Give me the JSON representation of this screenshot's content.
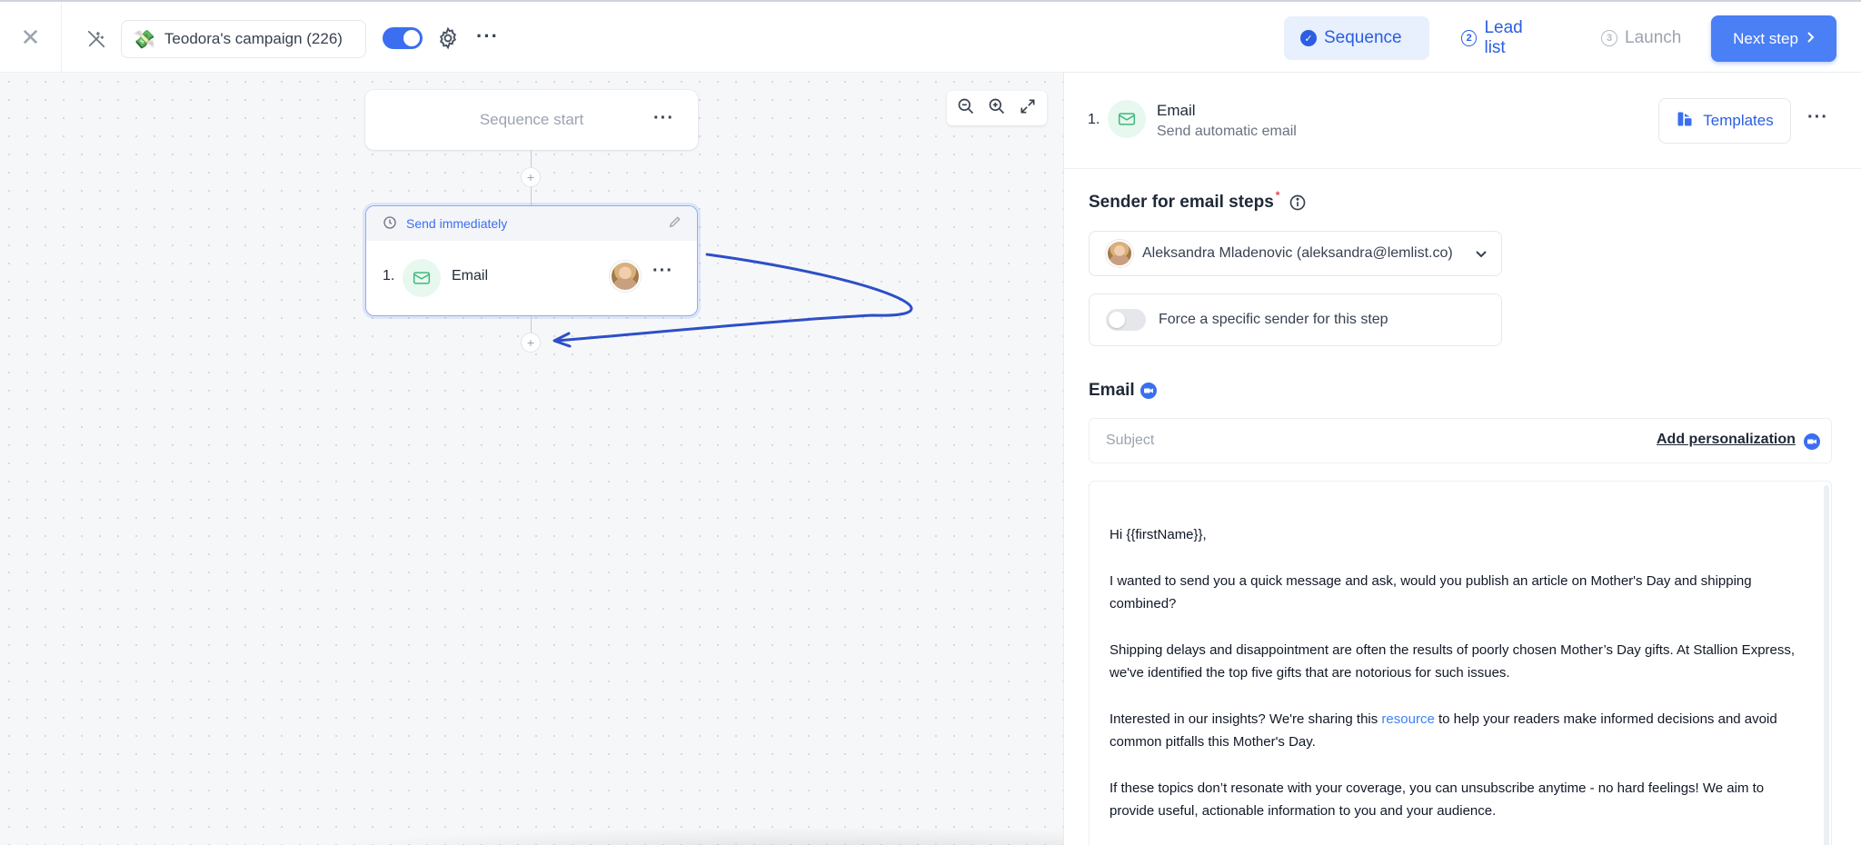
{
  "topbar": {
    "campaign_name": "Teodora's campaign (226)",
    "campaign_emoji": "💸",
    "steps": [
      {
        "label": "Sequence",
        "badge": "✓",
        "state": "active"
      },
      {
        "label": "Lead list",
        "badge": "2",
        "state": "next"
      },
      {
        "label": "Launch",
        "badge": "3",
        "state": "disabled"
      }
    ],
    "next_label": "Next step",
    "accent": "#3b6ff0"
  },
  "canvas": {
    "start_label": "Sequence start",
    "step": {
      "timing": "Send immediately",
      "number": "1.",
      "title": "Email"
    }
  },
  "panel": {
    "step_number": "1.",
    "title": "Email",
    "subtitle": "Send automatic email",
    "templates_label": "Templates",
    "sender_title": "Sender for email steps",
    "sender_required_mark": "*",
    "sender_value": "Aleksandra Mladenovic (aleksandra@lemlist.co)",
    "force_label": "Force a specific sender for this step",
    "email_title": "Email",
    "subject_placeholder": "Subject",
    "add_personalization": "Add personalization",
    "body": {
      "greeting": "Hi {{firstName}},",
      "p1": "I wanted to send you a quick message and ask, would you publish an article on Mother's Day and shipping combined?",
      "p2": "Shipping delays and disappointment are often the results of poorly chosen Mother’s Day gifts. At Stallion Express, we've identified the top five gifts that are notorious for such issues.",
      "p3_before": "Interested in our insights? We're sharing this ",
      "p3_link": "resource",
      "p3_after": " to help your readers make informed decisions and avoid common pitfalls this Mother's Day.",
      "p4": "If these topics don’t resonate with your coverage, you can unsubscribe anytime - no hard feelings! We aim to provide useful, actionable information to you and your audience."
    }
  }
}
